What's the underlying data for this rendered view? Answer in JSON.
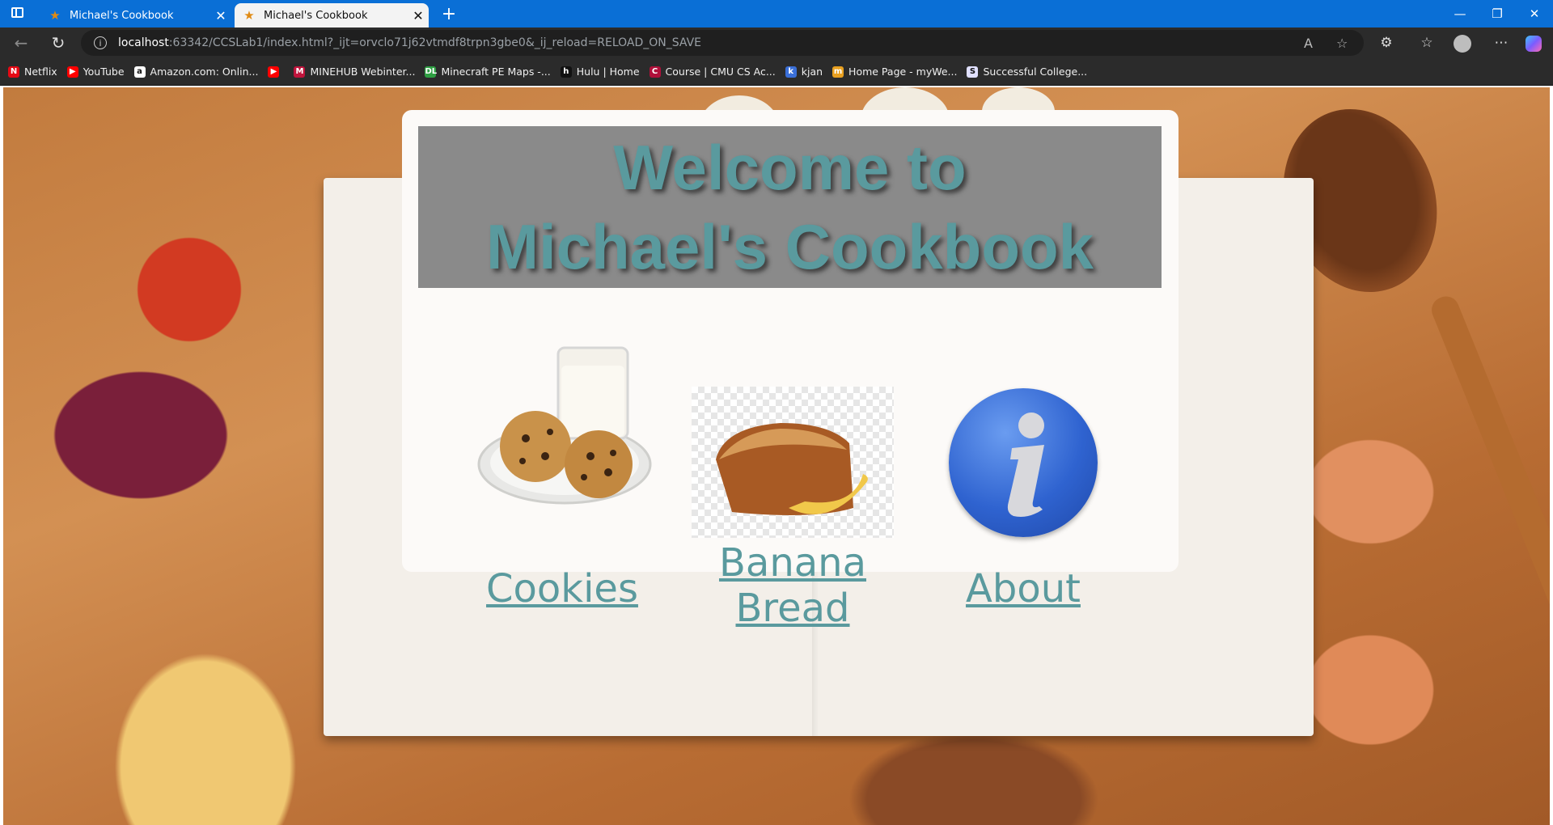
{
  "browser": {
    "tabs": [
      {
        "title": "Michael's Cookbook",
        "active": false
      },
      {
        "title": "Michael's Cookbook",
        "active": true
      }
    ],
    "url_host": "localhost",
    "url_rest": ":63342/CCSLab1/index.html?_ijt=orvclo71j62vtmdf8trpn3gbe0&_ij_reload=RELOAD_ON_SAVE",
    "bookmarks": [
      {
        "label": "Netflix",
        "icon": "netflix-icon",
        "color": "#e50914",
        "glyph": "N"
      },
      {
        "label": "YouTube",
        "icon": "youtube-icon",
        "color": "#ff0000",
        "glyph": "▶"
      },
      {
        "label": "Amazon.com: Onlin...",
        "icon": "amazon-icon",
        "color": "#ffffff",
        "glyph": "a"
      },
      {
        "label": "",
        "icon": "youtube-icon",
        "color": "#ff0000",
        "glyph": "▶"
      },
      {
        "label": "MINEHUB Webinter...",
        "icon": "minehub-icon",
        "color": "#c0143c",
        "glyph": "M"
      },
      {
        "label": "Minecraft PE Maps -...",
        "icon": "dl-icon",
        "color": "#2ea043",
        "glyph": "DL"
      },
      {
        "label": "Hulu | Home",
        "icon": "hulu-icon",
        "color": "#111111",
        "glyph": "h"
      },
      {
        "label": "Course | CMU CS Ac...",
        "icon": "cmu-icon",
        "color": "#b0103a",
        "glyph": "C"
      },
      {
        "label": "kjan",
        "icon": "kjan-icon",
        "color": "#3a6fd8",
        "glyph": "k"
      },
      {
        "label": "Home Page - myWe...",
        "icon": "myweb-icon",
        "color": "#e8a020",
        "glyph": "m"
      },
      {
        "label": "Successful College...",
        "icon": "college-icon",
        "color": "#e0e0ff",
        "glyph": "S"
      }
    ]
  },
  "page": {
    "title_line1": "Welcome to",
    "title_line2": "Michael's Cookbook",
    "links": [
      {
        "label": "Cookies",
        "image": "cookies-milk-image"
      },
      {
        "label": "Banana Bread",
        "image": "banana-bread-image"
      },
      {
        "label": "About",
        "image": "info-icon"
      }
    ],
    "colors": {
      "link": "#5a9a9e",
      "title_band": "#8a8a8a",
      "browser_chrome": "#0a6fd6"
    }
  }
}
